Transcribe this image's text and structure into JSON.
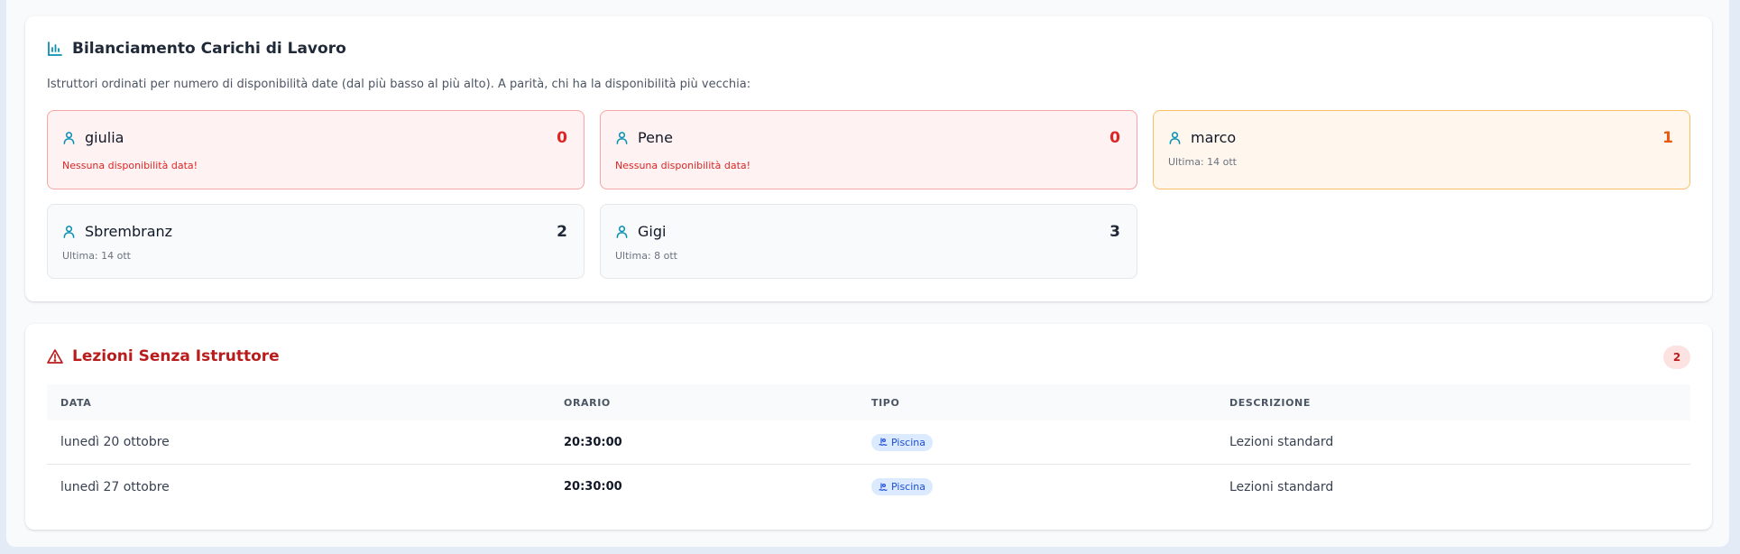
{
  "workload": {
    "title": "Bilanciamento Carichi di Lavoro",
    "subtitle": "Istruttori ordinati per numero di disponibilità date (dal più basso al più alto). A parità, chi ha la disponibilità più vecchia:",
    "instructors": [
      {
        "name": "giulia",
        "count": "0",
        "note": "Nessuna disponibilità data!",
        "status": "red"
      },
      {
        "name": "Pene",
        "count": "0",
        "note": "Nessuna disponibilità data!",
        "status": "red"
      },
      {
        "name": "marco",
        "count": "1",
        "note": "Ultima: 14 ott",
        "status": "orange"
      },
      {
        "name": "Sbrembranz",
        "count": "2",
        "note": "Ultima: 14 ott",
        "status": "gray"
      },
      {
        "name": "Gigi",
        "count": "3",
        "note": "Ultima: 8 ott",
        "status": "gray"
      }
    ]
  },
  "lessons": {
    "title": "Lezioni Senza Istruttore",
    "count": "2",
    "columns": {
      "data": "DATA",
      "orario": "ORARIO",
      "tipo": "TIPO",
      "descrizione": "DESCRIZIONE"
    },
    "rows": [
      {
        "data": "lunedì 20 ottobre",
        "orario": "20:30:00",
        "tipo": "Piscina",
        "descrizione": "Lezioni standard"
      },
      {
        "data": "lunedì 27 ottobre",
        "orario": "20:30:00",
        "tipo": "Piscina",
        "descrizione": "Lezioni standard"
      }
    ]
  },
  "colors": {
    "accent": "#0891b2",
    "danger": "#dc2626",
    "warning": "#ea580c"
  },
  "icons": {
    "workload_title": "bar-chart-icon",
    "instructor": "user-icon",
    "lessons_title": "warning-triangle-icon",
    "type": "pool-icon"
  }
}
